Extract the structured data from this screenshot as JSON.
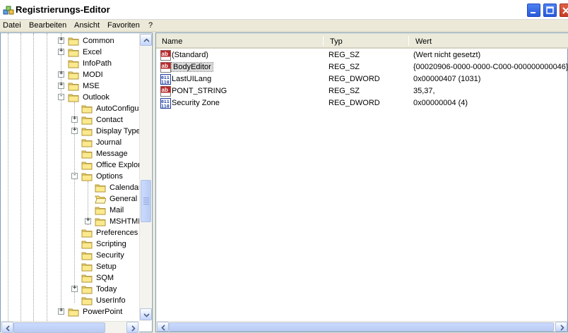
{
  "window": {
    "title": "Registrierungs-Editor"
  },
  "menu": {
    "items": [
      "Datei",
      "Bearbeiten",
      "Ansicht",
      "Favoriten",
      "?"
    ]
  },
  "tree": {
    "items": [
      {
        "label": "Common",
        "depth": 0,
        "expander": "+"
      },
      {
        "label": "Excel",
        "depth": 0,
        "expander": "+"
      },
      {
        "label": "InfoPath",
        "depth": 0,
        "expander": ""
      },
      {
        "label": "MODI",
        "depth": 0,
        "expander": "+"
      },
      {
        "label": "MSE",
        "depth": 0,
        "expander": "+"
      },
      {
        "label": "Outlook",
        "depth": 0,
        "expander": "-"
      },
      {
        "label": "AutoConfigu",
        "depth": 1,
        "expander": ""
      },
      {
        "label": "Contact",
        "depth": 1,
        "expander": "+"
      },
      {
        "label": "Display Type",
        "depth": 1,
        "expander": "+"
      },
      {
        "label": "Journal",
        "depth": 1,
        "expander": ""
      },
      {
        "label": "Message",
        "depth": 1,
        "expander": ""
      },
      {
        "label": "Office Explor",
        "depth": 1,
        "expander": ""
      },
      {
        "label": "Options",
        "depth": 1,
        "expander": "-"
      },
      {
        "label": "Calendar",
        "depth": 2,
        "expander": ""
      },
      {
        "label": "General",
        "depth": 2,
        "expander": "",
        "open": true
      },
      {
        "label": "Mail",
        "depth": 2,
        "expander": ""
      },
      {
        "label": "MSHTML",
        "depth": 2,
        "expander": "+"
      },
      {
        "label": "Preferences",
        "depth": 1,
        "expander": ""
      },
      {
        "label": "Scripting",
        "depth": 1,
        "expander": ""
      },
      {
        "label": "Security",
        "depth": 1,
        "expander": ""
      },
      {
        "label": "Setup",
        "depth": 1,
        "expander": ""
      },
      {
        "label": "SQM",
        "depth": 1,
        "expander": ""
      },
      {
        "label": "Today",
        "depth": 1,
        "expander": "+"
      },
      {
        "label": "UserInfo",
        "depth": 1,
        "expander": ""
      },
      {
        "label": "PowerPoint",
        "depth": 0,
        "expander": "+"
      }
    ]
  },
  "list": {
    "columns": {
      "name": "Name",
      "type": "Typ",
      "value": "Wert"
    },
    "rows": [
      {
        "name": "(Standard)",
        "type": "REG_SZ",
        "value": "(Wert nicht gesetzt)",
        "icon": "string-icon"
      },
      {
        "name": "BodyEditor",
        "type": "REG_SZ",
        "value": "{00020906-0000-0000-C000-000000000046}",
        "icon": "string-icon",
        "selected": true
      },
      {
        "name": "LastUILang",
        "type": "REG_DWORD",
        "value": "0x00000407 (1031)",
        "icon": "dword-icon"
      },
      {
        "name": "PONT_STRING",
        "type": "REG_SZ",
        "value": "35,37,",
        "icon": "string-icon"
      },
      {
        "name": "Security Zone",
        "type": "REG_DWORD",
        "value": "0x00000004 (4)",
        "icon": "dword-icon"
      }
    ]
  }
}
